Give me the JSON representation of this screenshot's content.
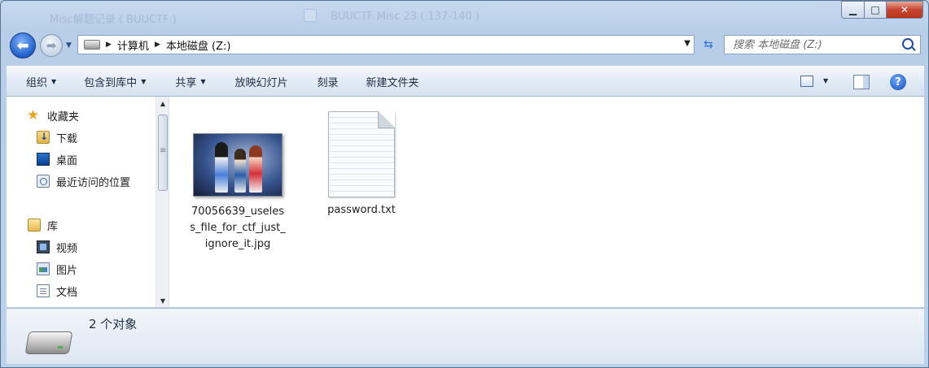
{
  "window": {
    "background_titles": [
      "Misc解题记录 ( BUUCTF )",
      "BUUCTF Misc 23 ( 137-140 )"
    ],
    "controls": {
      "minimize": "▁",
      "maximize": "□",
      "close": "✕"
    }
  },
  "navigation": {
    "back_glyph": "⬅",
    "forward_glyph": "➡",
    "breadcrumb": [
      "计算机",
      "本地磁盘 (Z:)"
    ],
    "search_placeholder": "搜索 本地磁盘 (Z:)"
  },
  "toolbar": {
    "items": [
      {
        "label": "组织",
        "has_dropdown": true
      },
      {
        "label": "包含到库中",
        "has_dropdown": true
      },
      {
        "label": "共享",
        "has_dropdown": true
      },
      {
        "label": "放映幻灯片",
        "has_dropdown": false
      },
      {
        "label": "刻录",
        "has_dropdown": false
      },
      {
        "label": "新建文件夹",
        "has_dropdown": false
      }
    ],
    "help_label": "?"
  },
  "sidebar": {
    "favorites": {
      "label": "收藏夹",
      "icon": "star-icon"
    },
    "favorite_items": [
      {
        "label": "下载",
        "icon": "downloads-folder-icon"
      },
      {
        "label": "桌面",
        "icon": "desktop-icon"
      },
      {
        "label": "最近访问的位置",
        "icon": "recent-places-icon"
      }
    ],
    "libraries": {
      "label": "库",
      "icon": "libraries-icon"
    },
    "library_items": [
      {
        "label": "视频",
        "icon": "video-library-icon"
      },
      {
        "label": "图片",
        "icon": "pictures-library-icon"
      },
      {
        "label": "文档",
        "icon": "documents-library-icon"
      }
    ]
  },
  "files": [
    {
      "name": "70056639_useless_file_for_ctf_just_ignore_it.jpg",
      "type": "image"
    },
    {
      "name": "password.txt",
      "type": "text"
    }
  ],
  "status": {
    "count_text": "2 个对象"
  },
  "colors": {
    "accent": "#1f5ec9",
    "close_button": "#c7452f",
    "chrome": "#bcd3ec"
  }
}
